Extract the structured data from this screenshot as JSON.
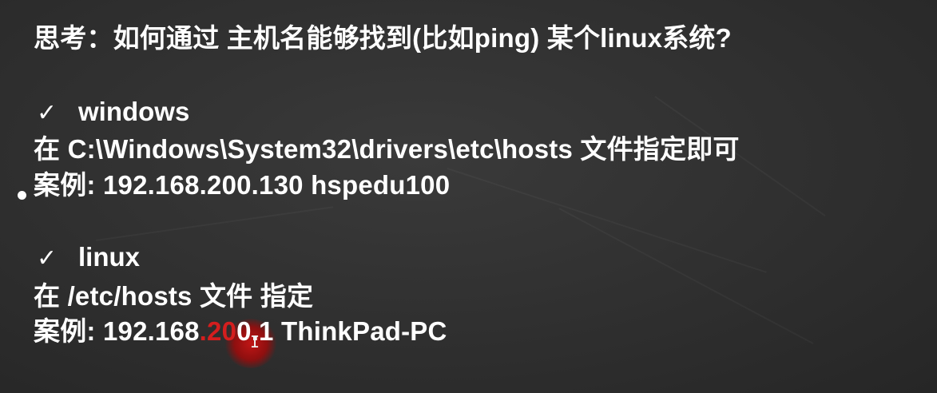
{
  "slide": {
    "title": "思考：如何通过 主机名能够找到(比如ping) 某个linux系统?",
    "windows": {
      "check_icon": "✓",
      "heading": "windows",
      "instruction": "在 C:\\Windows\\System32\\drivers\\etc\\hosts 文件指定即可",
      "example": "案例: 192.168.200.130 hspedu100"
    },
    "linux": {
      "check_icon": "✓",
      "heading": "linux",
      "instruction": "在 /etc/hosts 文件 指定",
      "example_prefix": "案例: 192.168",
      "example_highlight": ".20",
      "example_suffix": "0.1 ThinkPad-PC"
    }
  },
  "cursor": {
    "icon": "text-cursor-icon",
    "glyph": "I"
  },
  "colors": {
    "background": "#2f2f2f",
    "text": "#ffffff",
    "laser_pointer": "#c81414"
  }
}
